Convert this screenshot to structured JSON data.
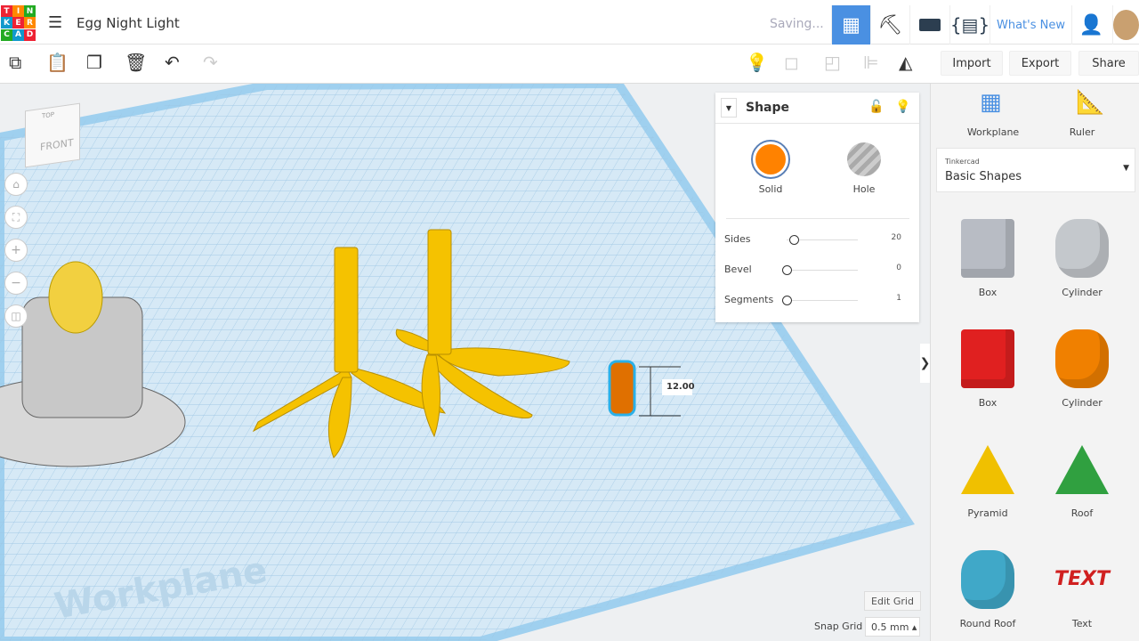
{
  "header": {
    "logo": [
      "TIN",
      "KER",
      "CAD"
    ],
    "title": "Egg Night Light",
    "status": "Saving...",
    "whats_new": "What's New"
  },
  "toolbar": {
    "import": "Import",
    "export": "Export",
    "share": "Share"
  },
  "shape_panel": {
    "title": "Shape",
    "solid": "Solid",
    "hole": "Hole",
    "solid_color": "#ff8200",
    "params": [
      {
        "label": "Sides",
        "value": "20",
        "fraction": 0.1
      },
      {
        "label": "Bevel",
        "value": "0",
        "fraction": 0
      },
      {
        "label": "Segments",
        "value": "1",
        "fraction": 0
      }
    ]
  },
  "viewcube": {
    "top": "TOP",
    "front": "FRONT"
  },
  "canvas": {
    "dimension": "12.00",
    "workplane_label": "Workplane",
    "edit_grid": "Edit Grid",
    "snap_grid_label": "Snap Grid",
    "snap_grid_value": "0.5 mm"
  },
  "sidebar": {
    "workplane": "Workplane",
    "ruler": "Ruler",
    "library_source": "Tinkercad",
    "library": "Basic Shapes",
    "shapes": [
      {
        "name": "Box",
        "color": "#b8bcc4"
      },
      {
        "name": "Cylinder",
        "color": "#c4c8cc"
      },
      {
        "name": "Box",
        "color": "#e02020"
      },
      {
        "name": "Cylinder",
        "color": "#f08000"
      },
      {
        "name": "Pyramid",
        "color": "#f0c000"
      },
      {
        "name": "Roof",
        "color": "#30a040"
      },
      {
        "name": "Round Roof",
        "color": "#40a8c8"
      },
      {
        "name": "Text",
        "color": "#d02020"
      }
    ]
  }
}
